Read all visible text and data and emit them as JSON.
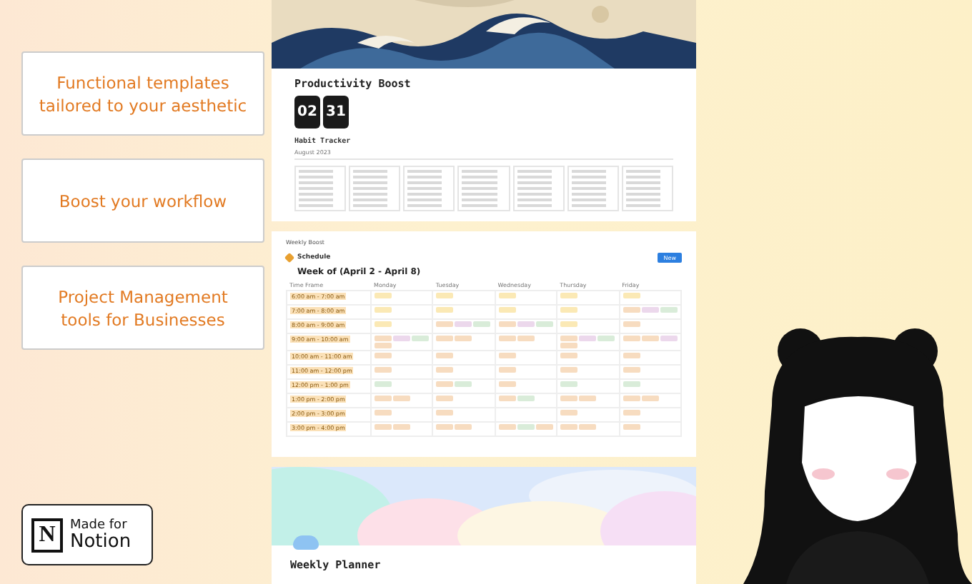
{
  "features": [
    "Functional templates tailored to your aesthetic",
    "Boost your workflow",
    "Project Management tools for Businesses"
  ],
  "badge": {
    "line1": "Made for",
    "line2": "Notion",
    "glyph": "N"
  },
  "productivity": {
    "title": "Productivity Boost",
    "clock": [
      "02",
      "31"
    ],
    "tracker_title": "Habit Tracker",
    "month": "August 2023"
  },
  "schedule": {
    "breadcrumb": "Weekly Boost",
    "heading": "Schedule",
    "button": "New",
    "week": "Week of (April 2 - April 8)",
    "columns": [
      "Time Frame",
      "Monday",
      "Tuesday",
      "Wednesday",
      "Thursday",
      "Friday"
    ],
    "rows": [
      {
        "time": "6:00 am - 7:00 am",
        "cells": [
          [
            {
              "color": "#fbe9b5"
            }
          ],
          [
            {
              "color": "#fbe9b5"
            }
          ],
          [
            {
              "color": "#fbe9b5"
            }
          ],
          [
            {
              "color": "#fbe9b5"
            }
          ],
          [
            {
              "color": "#fbe9b5"
            }
          ]
        ]
      },
      {
        "time": "7:00 am - 8:00 am",
        "cells": [
          [
            {
              "color": "#fbe9b5"
            }
          ],
          [
            {
              "color": "#fbe9b5"
            }
          ],
          [
            {
              "color": "#fbe9b5"
            }
          ],
          [
            {
              "color": "#fbe9b5"
            }
          ],
          [
            {
              "color": "#f7dcc0"
            },
            {
              "color": "#ecd8ec"
            },
            {
              "color": "#d9ecd9"
            }
          ]
        ]
      },
      {
        "time": "8:00 am - 9:00 am",
        "cells": [
          [
            {
              "color": "#fbe9b5"
            }
          ],
          [
            {
              "color": "#f7dcc0"
            },
            {
              "color": "#ecd8ec"
            },
            {
              "color": "#d9ecd9"
            }
          ],
          [
            {
              "color": "#f7dcc0"
            },
            {
              "color": "#ecd8ec"
            },
            {
              "color": "#d9ecd9"
            }
          ],
          [
            {
              "color": "#fbe9b5"
            }
          ],
          [
            {
              "color": "#f7dcc0"
            }
          ]
        ]
      },
      {
        "time": "9:00 am - 10:00 am",
        "cells": [
          [
            {
              "color": "#f7dcc0"
            },
            {
              "color": "#ecd8ec"
            },
            {
              "color": "#d9ecd9"
            },
            {
              "color": "#f7dcc0"
            }
          ],
          [
            {
              "color": "#f7dcc0"
            },
            {
              "color": "#f7dcc0"
            }
          ],
          [
            {
              "color": "#f7dcc0"
            },
            {
              "color": "#f7dcc0"
            }
          ],
          [
            {
              "color": "#f7dcc0"
            },
            {
              "color": "#ecd8ec"
            },
            {
              "color": "#d9ecd9"
            },
            {
              "color": "#f7dcc0"
            }
          ],
          [
            {
              "color": "#f7dcc0"
            },
            {
              "color": "#f7dcc0"
            },
            {
              "color": "#ecd8ec"
            }
          ]
        ]
      },
      {
        "time": "10:00 am - 11:00 am",
        "cells": [
          [
            {
              "color": "#f7dcc0"
            }
          ],
          [
            {
              "color": "#f7dcc0"
            }
          ],
          [
            {
              "color": "#f7dcc0"
            }
          ],
          [
            {
              "color": "#f7dcc0"
            }
          ],
          [
            {
              "color": "#f7dcc0"
            }
          ]
        ]
      },
      {
        "time": "11:00 am - 12:00 pm",
        "cells": [
          [
            {
              "color": "#f7dcc0"
            }
          ],
          [
            {
              "color": "#f7dcc0"
            }
          ],
          [
            {
              "color": "#f7dcc0"
            }
          ],
          [
            {
              "color": "#f7dcc0"
            }
          ],
          [
            {
              "color": "#f7dcc0"
            }
          ]
        ]
      },
      {
        "time": "12:00 pm - 1:00 pm",
        "cells": [
          [
            {
              "color": "#d9ecd9"
            }
          ],
          [
            {
              "color": "#f7dcc0"
            },
            {
              "color": "#d9ecd9"
            }
          ],
          [
            {
              "color": "#f7dcc0"
            }
          ],
          [
            {
              "color": "#d9ecd9"
            }
          ],
          [
            {
              "color": "#d9ecd9"
            }
          ]
        ]
      },
      {
        "time": "1:00 pm - 2:00 pm",
        "cells": [
          [
            {
              "color": "#f7dcc0"
            },
            {
              "color": "#f7dcc0"
            }
          ],
          [
            {
              "color": "#f7dcc0"
            }
          ],
          [
            {
              "color": "#f7dcc0"
            },
            {
              "color": "#d9ecd9"
            }
          ],
          [
            {
              "color": "#f7dcc0"
            },
            {
              "color": "#f7dcc0"
            }
          ],
          [
            {
              "color": "#f7dcc0"
            },
            {
              "color": "#f7dcc0"
            }
          ]
        ]
      },
      {
        "time": "2:00 pm - 3:00 pm",
        "cells": [
          [
            {
              "color": "#f7dcc0"
            }
          ],
          [
            {
              "color": "#f7dcc0"
            }
          ],
          [],
          [
            {
              "color": "#f7dcc0"
            }
          ],
          [
            {
              "color": "#f7dcc0"
            }
          ]
        ]
      },
      {
        "time": "3:00 pm - 4:00 pm",
        "cells": [
          [
            {
              "color": "#f7dcc0"
            },
            {
              "color": "#f7dcc0"
            }
          ],
          [
            {
              "color": "#f7dcc0"
            },
            {
              "color": "#f7dcc0"
            }
          ],
          [
            {
              "color": "#f7dcc0"
            },
            {
              "color": "#d9ecd9"
            },
            {
              "color": "#f7dcc0"
            }
          ],
          [
            {
              "color": "#f7dcc0"
            },
            {
              "color": "#f7dcc0"
            }
          ],
          [
            {
              "color": "#f7dcc0"
            }
          ]
        ]
      }
    ]
  },
  "planner": {
    "title": "Weekly Planner"
  }
}
